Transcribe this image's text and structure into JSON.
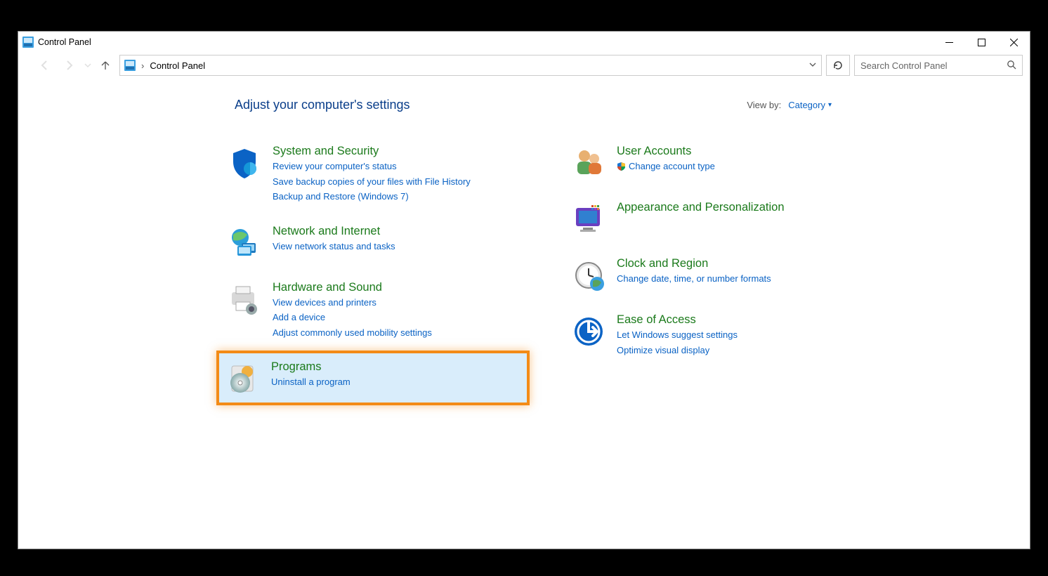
{
  "window": {
    "title": "Control Panel",
    "breadcrumb": "Control Panel",
    "search_placeholder": "Search Control Panel"
  },
  "header": {
    "heading": "Adjust your computer's settings",
    "viewby_label": "View by:",
    "viewby_value": "Category"
  },
  "categories": {
    "system_security": {
      "title": "System and Security",
      "links": [
        "Review your computer's status",
        "Save backup copies of your files with File History",
        "Backup and Restore (Windows 7)"
      ]
    },
    "network": {
      "title": "Network and Internet",
      "links": [
        "View network status and tasks"
      ]
    },
    "hardware": {
      "title": "Hardware and Sound",
      "links": [
        "View devices and printers",
        "Add a device",
        "Adjust commonly used mobility settings"
      ]
    },
    "programs": {
      "title": "Programs",
      "links": [
        "Uninstall a program"
      ]
    },
    "users": {
      "title": "User Accounts",
      "links": [
        "Change account type"
      ]
    },
    "appearance": {
      "title": "Appearance and Personalization"
    },
    "clock": {
      "title": "Clock and Region",
      "links": [
        "Change date, time, or number formats"
      ]
    },
    "ease": {
      "title": "Ease of Access",
      "links": [
        "Let Windows suggest settings",
        "Optimize visual display"
      ]
    }
  }
}
